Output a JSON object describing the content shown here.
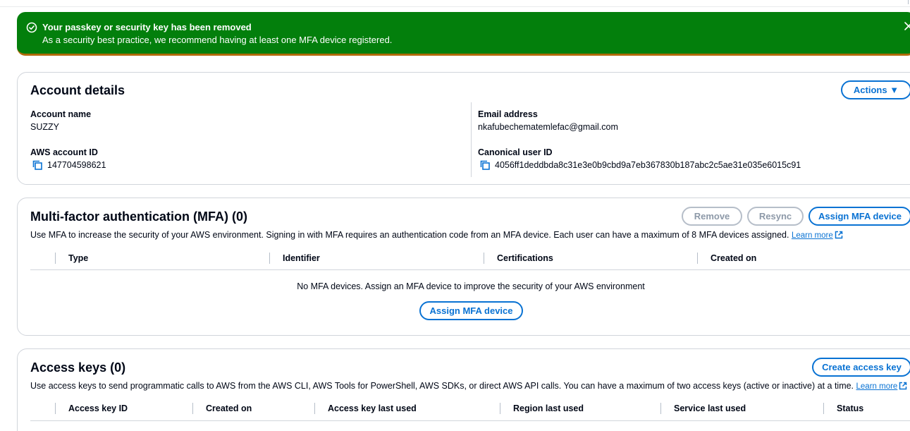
{
  "flash": {
    "title": "Your passkey or security key has been removed",
    "description": "As a security best practice, we recommend having at least one MFA device registered.",
    "success_color": "#037f0c",
    "icons": {
      "status": "check-circle-icon",
      "close": "close-icon"
    }
  },
  "account_details": {
    "title": "Account details",
    "actions_label": "Actions ▼",
    "account_name_label": "Account name",
    "account_name": "SUZZY",
    "aws_account_id_label": "AWS account ID",
    "aws_account_id": "147704598621",
    "email_label": "Email address",
    "email": "nkafubechematemlefac@gmail.com",
    "canonical_id_label": "Canonical user ID",
    "canonical_id": "4056ff1deddbda8c31e3e0b9cbd9a7eb367830b187abc2c5ae31e035e6015c91"
  },
  "mfa": {
    "title": "Multi-factor authentication (MFA) (0)",
    "remove_label": "Remove",
    "resync_label": "Resync",
    "assign_label": "Assign MFA device",
    "description": "Use MFA to increase the security of your AWS environment. Signing in with MFA requires an authentication code from an MFA device. Each user can have a maximum of 8 MFA devices assigned.",
    "learn_more": "Learn more",
    "columns": [
      "Type",
      "Identifier",
      "Certifications",
      "Created on"
    ],
    "empty_message": "No MFA devices. Assign an MFA device to improve the security of your AWS environment",
    "empty_assign_label": "Assign MFA device"
  },
  "access_keys": {
    "title": "Access keys (0)",
    "create_label": "Create access key",
    "description": "Use access keys to send programmatic calls to AWS from the AWS CLI, AWS Tools for PowerShell, AWS SDKs, or direct AWS API calls. You can have a maximum of two access keys (active or inactive) at a time.",
    "learn_more": "Learn more",
    "columns": [
      "Access key ID",
      "Created on",
      "Access key last used",
      "Region last used",
      "Service last used",
      "Status"
    ]
  },
  "colors": {
    "primary": "#0972d3",
    "success": "#037f0c",
    "border": "#d1d5db"
  }
}
